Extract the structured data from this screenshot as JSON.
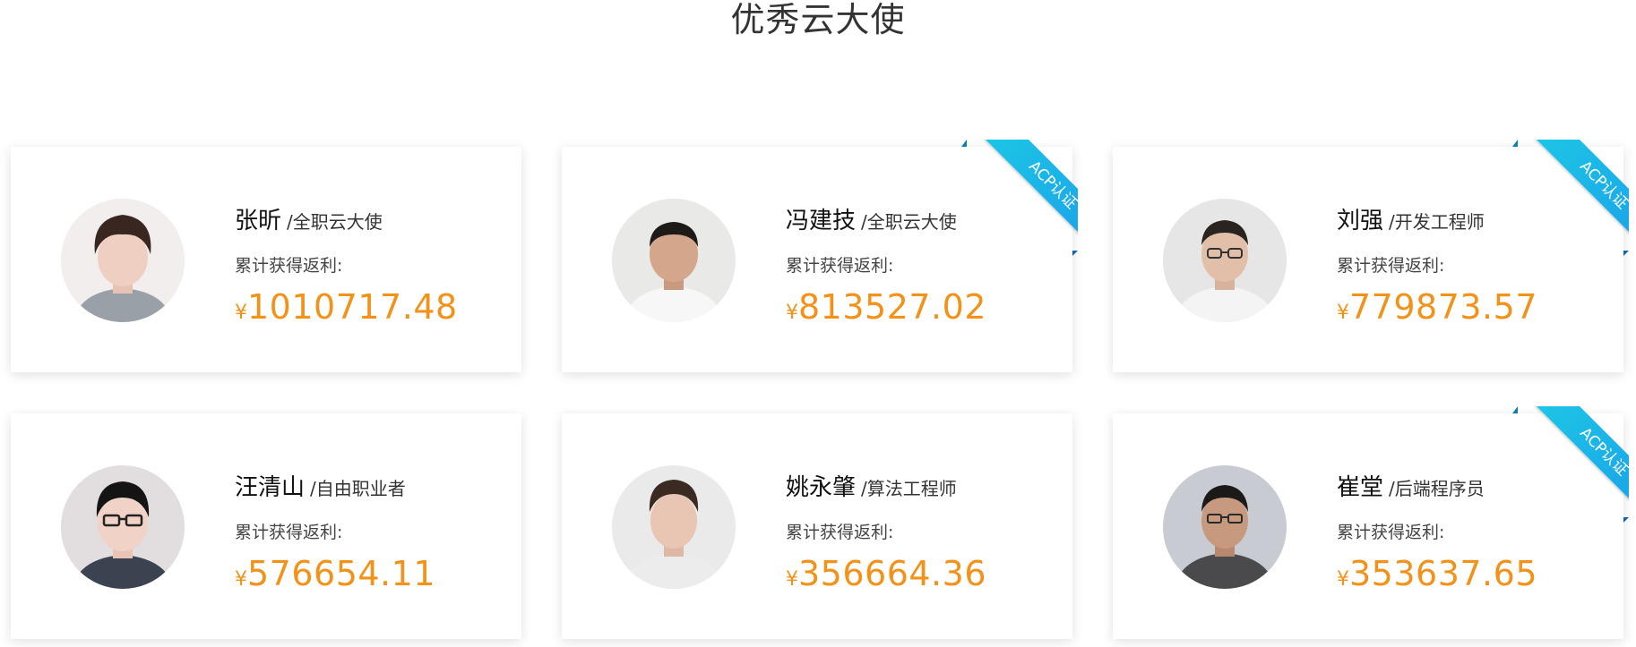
{
  "section": {
    "title": "优秀云大使"
  },
  "rebate_label": "累计获得返利:",
  "currency_symbol": "¥",
  "badge_text": "ACP认证",
  "colors": {
    "amount": "#f29219",
    "badge": "#1cb4e8",
    "title": "#333333"
  },
  "ambassadors": [
    {
      "name": "张昕",
      "role": "/全职云大使",
      "amount": "1010717.48",
      "acp_certified": false
    },
    {
      "name": "冯建技",
      "role": "/全职云大使",
      "amount": "813527.02",
      "acp_certified": true
    },
    {
      "name": "刘强",
      "role": "/开发工程师",
      "amount": "779873.57",
      "acp_certified": true
    },
    {
      "name": "汪清山",
      "role": "/自由职业者",
      "amount": "576654.11",
      "acp_certified": false
    },
    {
      "name": "姚永肇",
      "role": "/算法工程师",
      "amount": "356664.36",
      "acp_certified": false
    },
    {
      "name": "崔堂",
      "role": "/后端程序员",
      "amount": "353637.65",
      "acp_certified": true
    }
  ]
}
